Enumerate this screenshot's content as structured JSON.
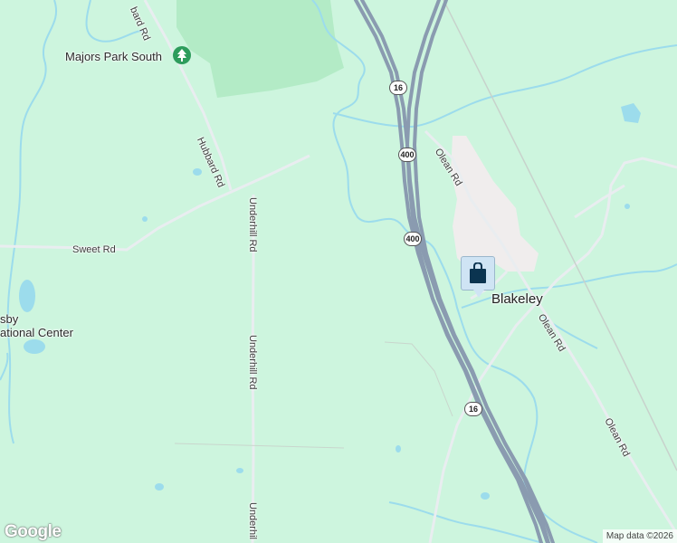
{
  "map": {
    "colors": {
      "land": "#cdf5de",
      "park": "#b3ebc6",
      "water": "#9cdcec",
      "highway": "#8a9bb0",
      "road": "#e9edf0",
      "developed": "#f0eded"
    },
    "places": {
      "park_name": "Majors Park South",
      "town": "Blakeley",
      "partial_label_1": "sby",
      "partial_label_2": "ational Center"
    },
    "roads": {
      "hubbard": "Hubbard Rd",
      "hubbard_top": "bard Rd",
      "sweet": "Sweet Rd",
      "underhill_1": "Underhill Rd",
      "underhill_2": "Underhill Rd",
      "underhill_3": "Underhil",
      "olean_1": "Olean Rd",
      "olean_2": "Olean Rd",
      "olean_3": "Olean Rd"
    },
    "shields": {
      "s16_top": "16",
      "s400_a": "400",
      "s400_b": "400",
      "s16_bottom": "16"
    },
    "icons": {
      "park": "tree-icon",
      "marker": "shopping-bag-icon"
    },
    "footer": {
      "logo": "Google",
      "attribution": "Map data ©2026"
    }
  }
}
